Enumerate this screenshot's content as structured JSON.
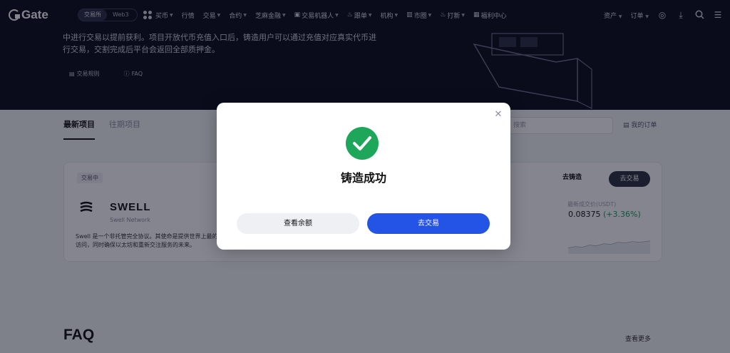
{
  "nav": {
    "logo": "Gate",
    "mode_tabs": [
      "交易所",
      "Web3"
    ],
    "menu": [
      {
        "label": "买币",
        "caret": true
      },
      {
        "label": "行情",
        "caret": false
      },
      {
        "label": "交易",
        "caret": true
      },
      {
        "label": "合约",
        "caret": true
      },
      {
        "label": "芝麻金融",
        "caret": true
      },
      {
        "label": "交易机器人",
        "caret": true
      },
      {
        "label": "跟单",
        "caret": true
      },
      {
        "label": "机构",
        "caret": true
      },
      {
        "label": "市圈",
        "caret": true
      },
      {
        "label": "打新",
        "caret": true
      },
      {
        "label": "福利中心",
        "caret": false
      }
    ],
    "right": [
      {
        "label": "资产",
        "caret": true
      },
      {
        "label": "订单",
        "caret": true
      }
    ]
  },
  "hero": {
    "description": "中进行交易以提前获利。项目开放代币充值入口后，铸造用户可以通过充值对应真实代币进行交易，交割完成后平台会返回全部质押金。",
    "links": [
      "交易规则",
      "FAQ"
    ]
  },
  "content": {
    "tabs": [
      "最新项目",
      "往期项目"
    ],
    "search_placeholder": "搜索",
    "my_orders": "我的订单",
    "card": {
      "badge": "交易中",
      "name": "SWELL",
      "subname": "Swell Network",
      "description": "Swell 是一个非托管完全协议。其使命是提供世界上最的访问，同时确保以太坊和重新交注服务的未来。",
      "mint_label": "去铸造",
      "trade_label": "去交易",
      "price_label": "最新成交价(USDT)",
      "price": "0.08375",
      "change": "(+3.36%)"
    }
  },
  "modal": {
    "title": "铸造成功",
    "btn_balance": "查看余额",
    "btn_trade": "去交易"
  },
  "faq": {
    "title": "FAQ",
    "see_more": "查看更多"
  }
}
